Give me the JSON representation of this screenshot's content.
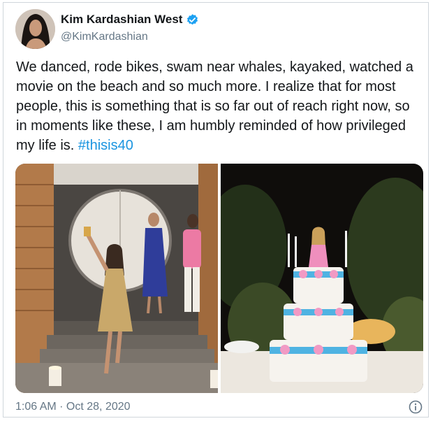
{
  "tweet": {
    "display_name": "Kim Kardashian West",
    "handle": "@KimKardashian",
    "text_main": "We danced, rode bikes, swam near whales, kayaked, watched a movie on the beach and so much more. I realize that for most people, this is something that is so far out of reach right now, so in moments like these, I am humbly reminded of how privileged my life is. ",
    "hashtag": "#thisis40",
    "timestamp": "1:06 AM · Oct 28, 2020"
  },
  "icons": {
    "verified": "verified-badge-icon",
    "info": "info-icon"
  },
  "colors": {
    "hashtag": "#1b95e0",
    "verified": "#1da1f2",
    "secondary_text": "#657786"
  }
}
